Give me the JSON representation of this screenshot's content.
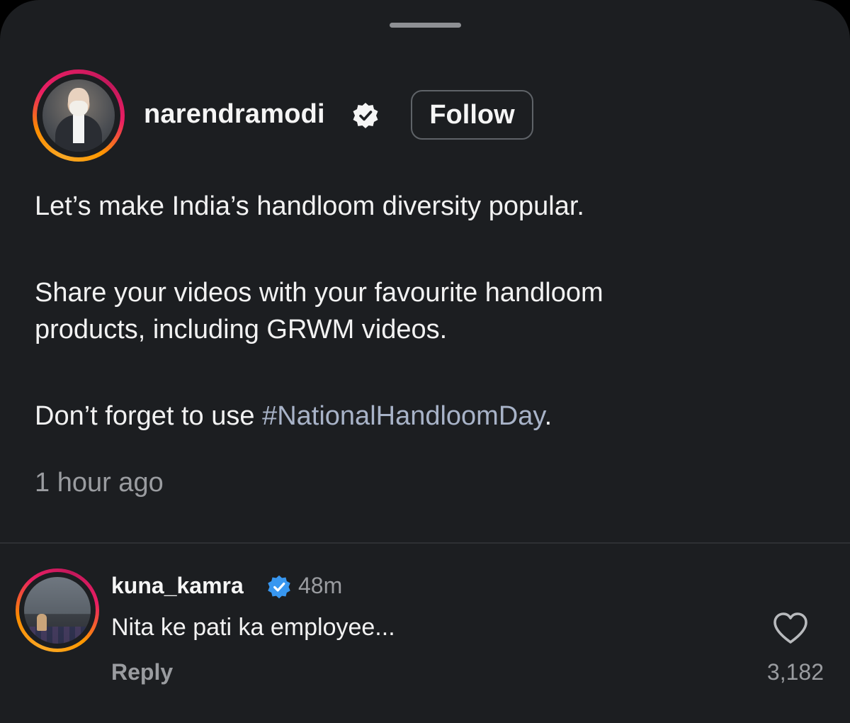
{
  "post": {
    "username": "narendramodi",
    "verified": true,
    "follow_label": "Follow",
    "caption_lines": [
      "Let’s make India’s handloom diversity popular.",
      "Share your videos with your favourite handloom",
      "products, including GRWM videos.",
      "Don’t forget to use "
    ],
    "hashtag": "#NationalHandloomDay",
    "caption_end": ".",
    "timestamp": "1 hour ago"
  },
  "comment": {
    "username": "kuna_kamra",
    "verified": true,
    "time": "48m",
    "text": "Nita ke pati ka employee...",
    "reply_label": "Reply",
    "likes": "3,182"
  },
  "icons": {
    "post_verified": "verified-badge-icon",
    "comment_verified": "verified-badge-icon",
    "like": "heart-icon"
  },
  "colors": {
    "background": "#1c1e21",
    "text": "#f5f5f5",
    "secondary_text": "#9a9ca0",
    "hashtag": "#a8b3c8",
    "verified_blue": "#3897f0",
    "story_ring_start": "#f9a825",
    "story_ring_end": "#e91e63"
  }
}
